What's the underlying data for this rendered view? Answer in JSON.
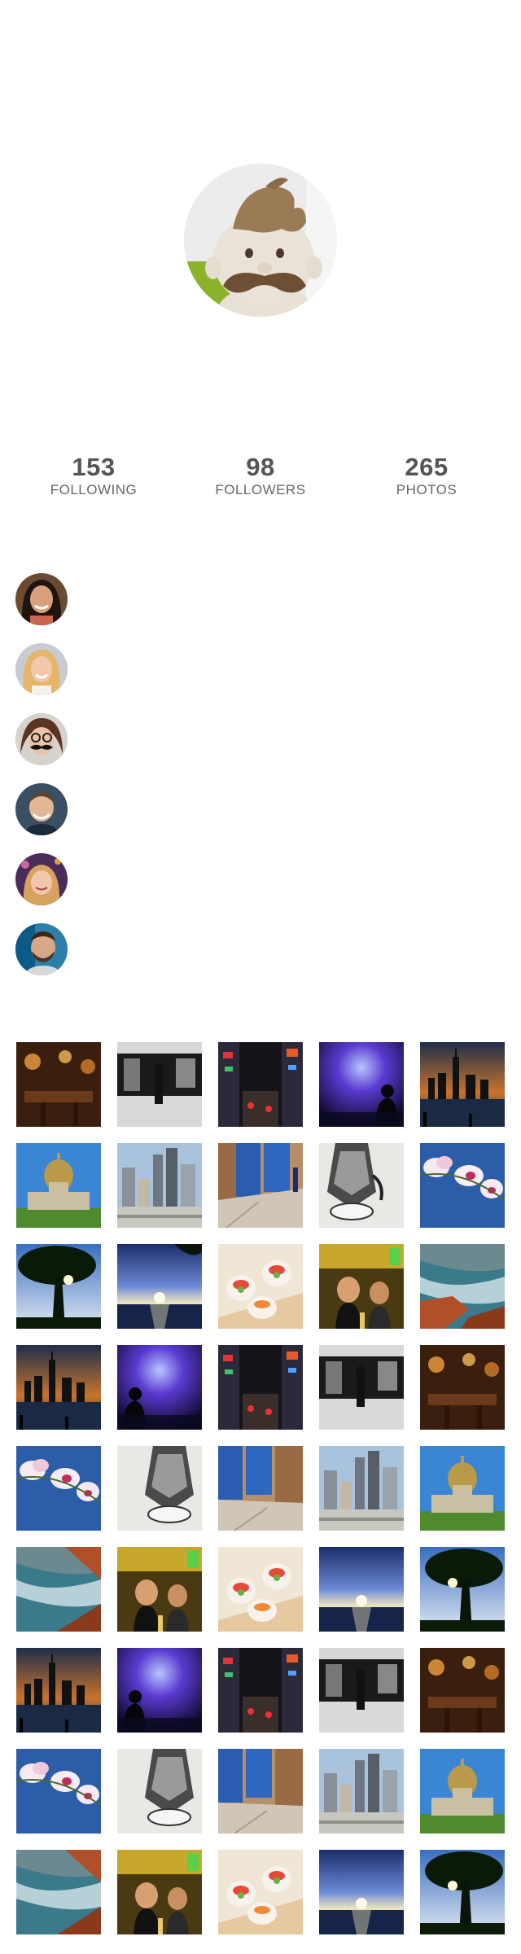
{
  "stats": [
    {
      "value": "153",
      "label": "FOLLOWING"
    },
    {
      "value": "98",
      "label": "FOLLOWERS"
    },
    {
      "value": "265",
      "label": "PHOTOS"
    }
  ],
  "following_avatars": [
    "avatar-woman-dark-hair",
    "avatar-woman-blonde-hair",
    "avatar-woman-glasses-mustache",
    "avatar-man-smiling",
    "avatar-woman-red-hair",
    "avatar-man-beard"
  ],
  "photo_grid": [
    [
      "restaurant",
      "bar-interior",
      "city-night-street",
      "concert",
      "night-skyline"
    ],
    [
      "dome-building",
      "city-buildings",
      "blue-fence",
      "sneakers",
      "orchid"
    ],
    [
      "tree-sunset",
      "sunset-sea",
      "sushi",
      "friends-dinner",
      "coast-waves"
    ],
    [
      "night-skyline",
      "concert",
      "city-night-street",
      "bar-interior",
      "restaurant"
    ],
    [
      "orchid",
      "sneakers",
      "blue-fence",
      "city-buildings",
      "dome-building"
    ],
    [
      "coast-waves",
      "friends-dinner",
      "sushi",
      "sunset-sea",
      "tree-sunset"
    ],
    [
      "night-skyline",
      "concert",
      "city-night-street",
      "bar-interior",
      "restaurant"
    ],
    [
      "orchid",
      "sneakers",
      "blue-fence",
      "city-buildings",
      "dome-building"
    ],
    [
      "coast-waves",
      "friends-dinner",
      "sushi",
      "sunset-sea",
      "tree-sunset"
    ]
  ]
}
